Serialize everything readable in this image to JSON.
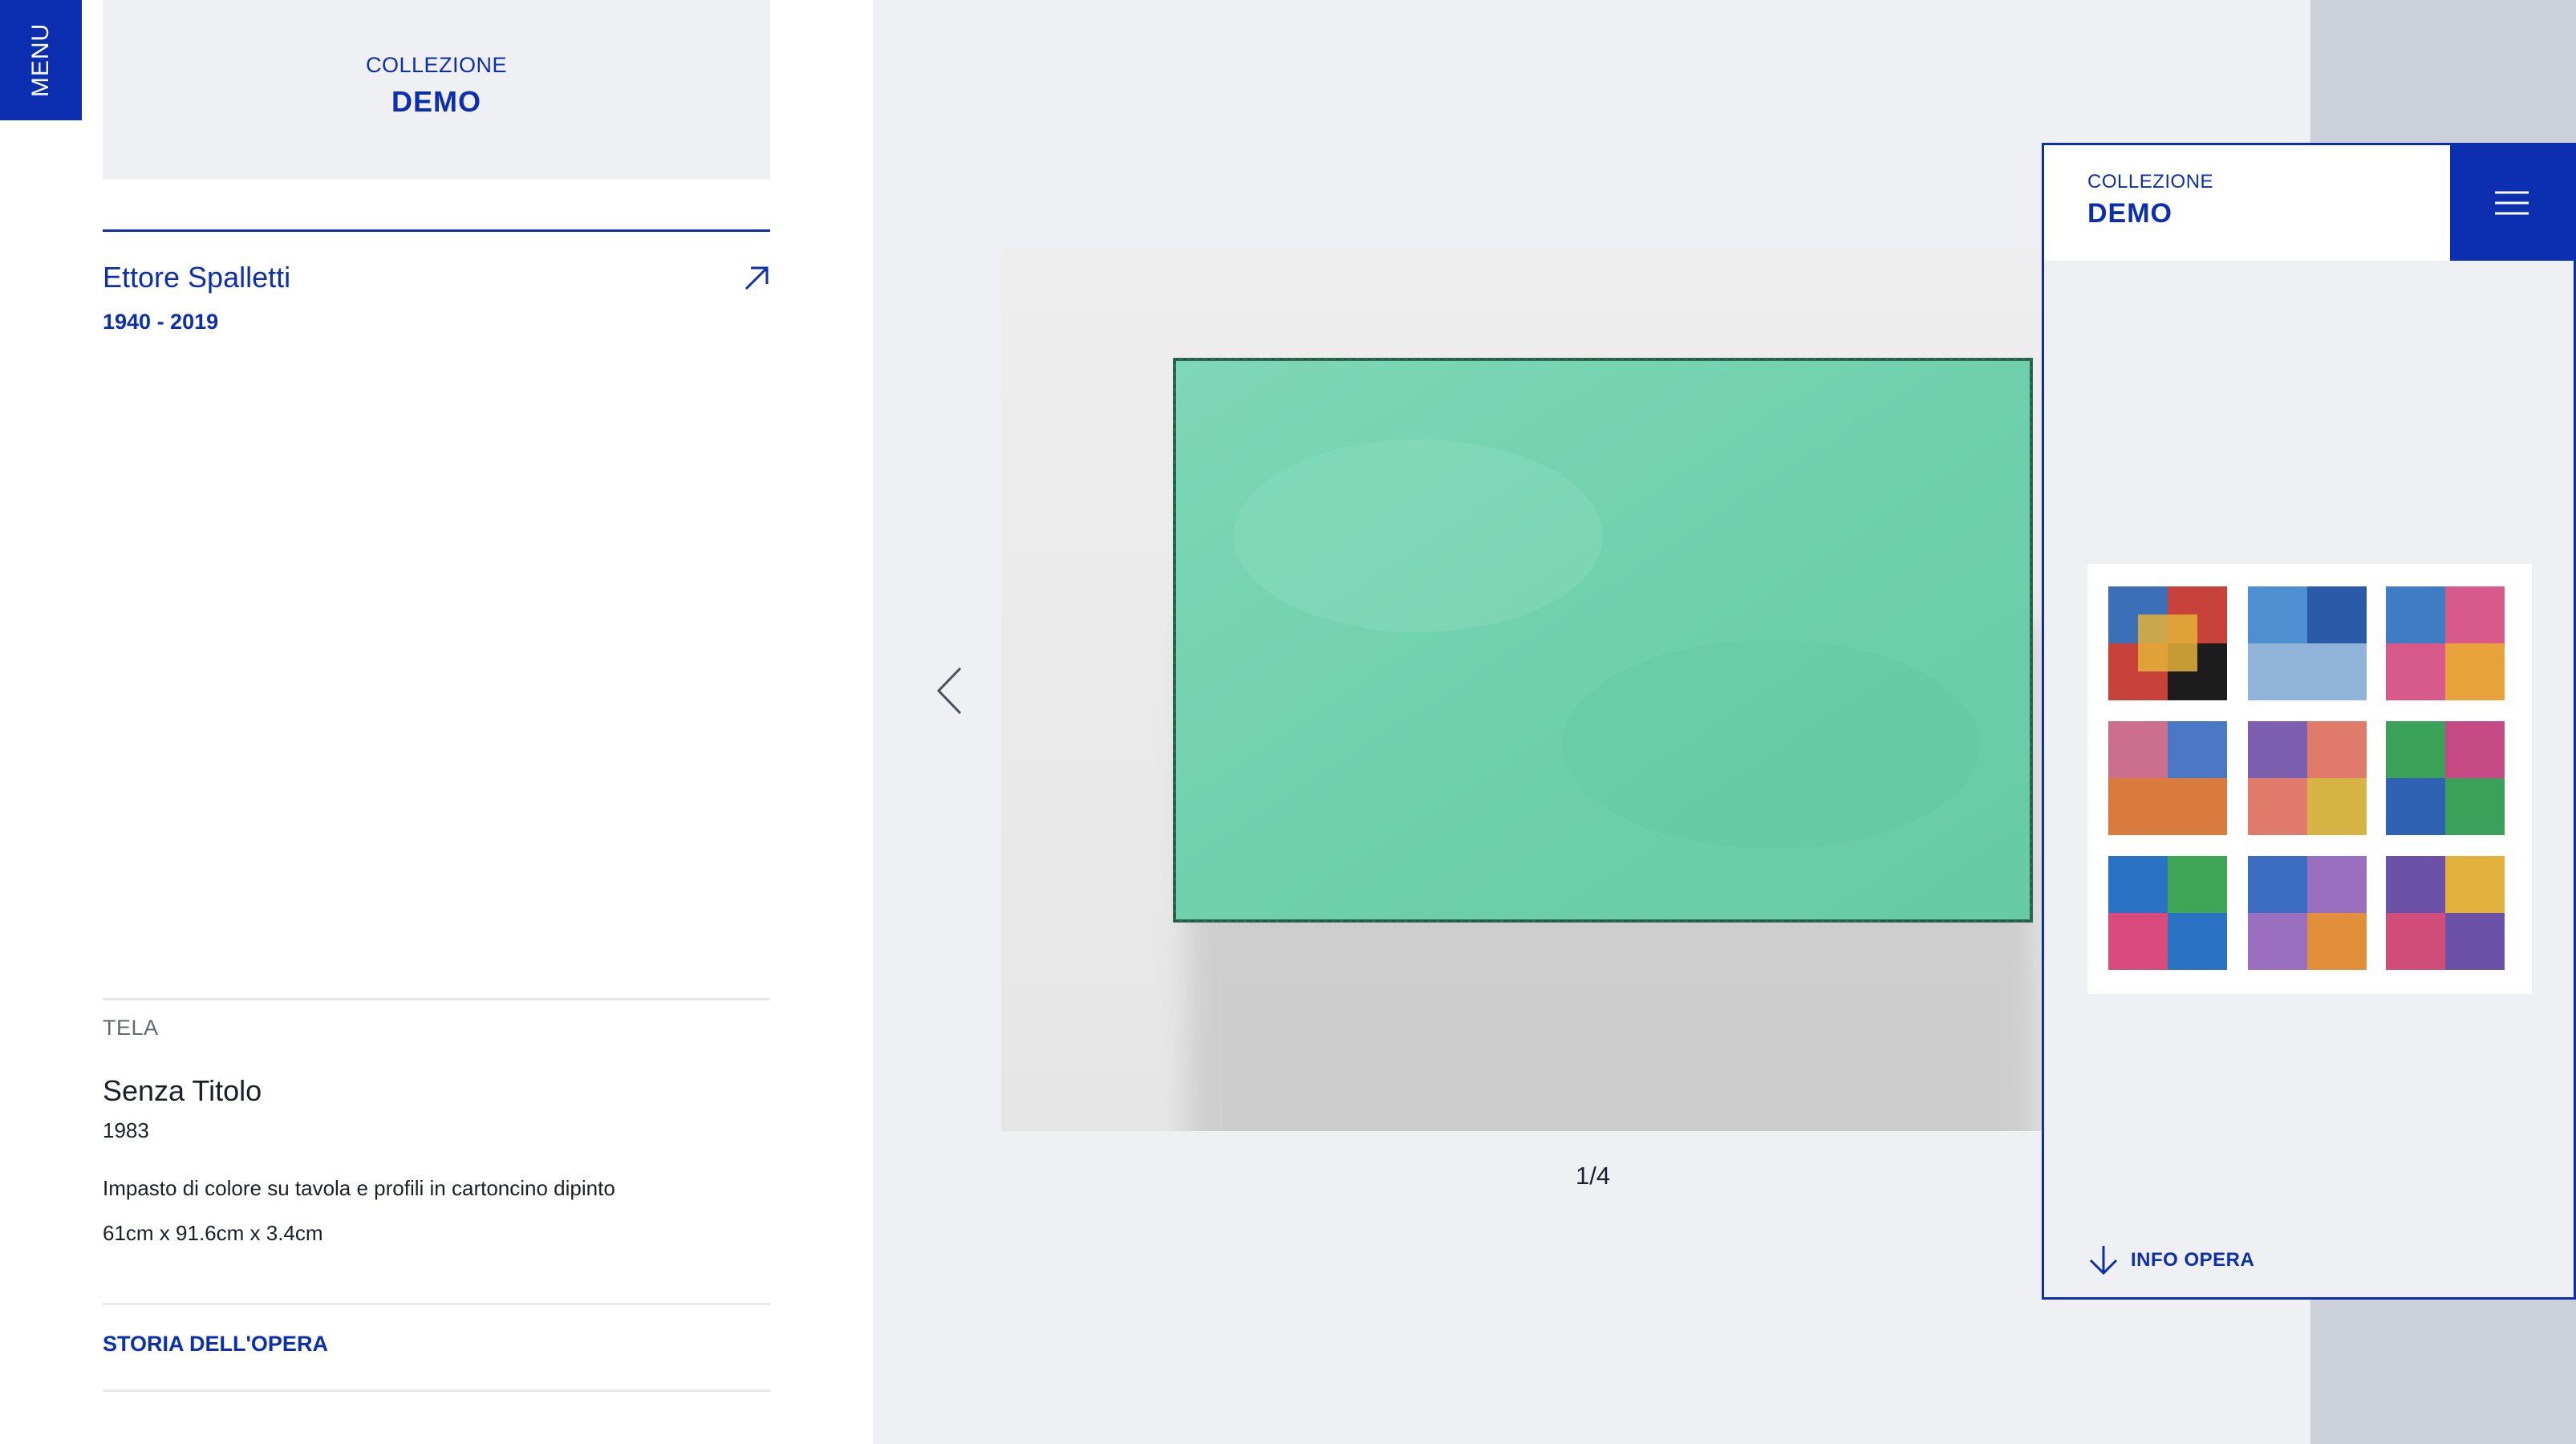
{
  "menu": {
    "label": "MENU"
  },
  "brand": {
    "line1": "COLLEZIONE",
    "line2": "DEMO"
  },
  "artist": {
    "name": "Ettore Spalletti",
    "years": "1940 - 2019"
  },
  "artwork": {
    "category": "TELA",
    "title": "Senza Titolo",
    "year": "1983",
    "technique": "Impasto di colore su tavola e profili in cartoncino dipinto",
    "dimensions": "61cm x 91.6cm x 3.4cm"
  },
  "links": {
    "history": "STORIA DELL'OPERA"
  },
  "viewer": {
    "counter": "1/4"
  },
  "mobile": {
    "brand_line1": "COLLEZIONE",
    "brand_line2": "DEMO",
    "info_label": "INFO OPERA"
  },
  "colors": {
    "brand_blue": "#0b2fb0",
    "panel_grey": "#eff0f3",
    "artwork_green": "#74d3b2"
  },
  "icons": {
    "external": "arrow-up-right-icon",
    "prev": "chevron-left-icon",
    "hamburger": "hamburger-icon",
    "info": "arrow-down-icon"
  }
}
